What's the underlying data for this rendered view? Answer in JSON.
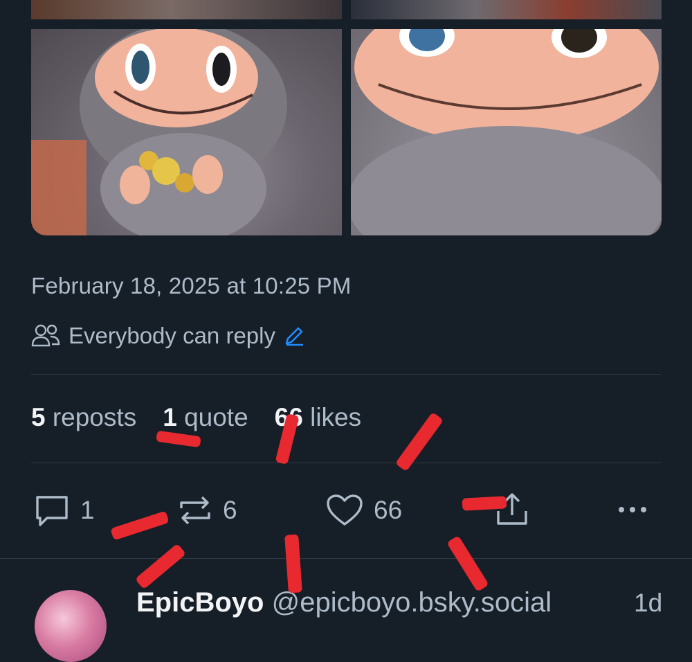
{
  "post": {
    "timestamp": "February 18, 2025 at 10:25 PM",
    "reply_setting": "Everybody can reply",
    "stats": {
      "reposts_count": "5",
      "reposts_label": "reposts",
      "quotes_count": "1",
      "quotes_label": "quote",
      "likes_count": "66",
      "likes_label": "likes"
    },
    "actions": {
      "reply_count": "1",
      "repost_count": "6",
      "like_count": "66"
    }
  },
  "next_reply": {
    "display_name": "EpicBoyo",
    "handle": "@epicboyo.bsky.social",
    "age": "1d"
  },
  "colors": {
    "background": "#161e27",
    "text_muted": "#aebbc9",
    "text_strong": "#f1f3f5",
    "accent": "#208bfe",
    "annotation": "#e8292f"
  }
}
